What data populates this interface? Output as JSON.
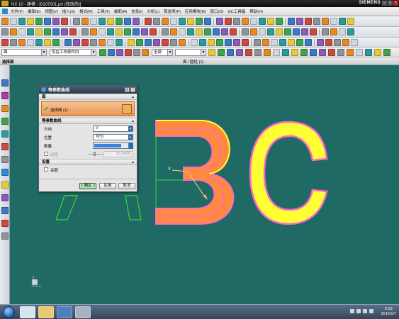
{
  "window": {
    "title": "NX 10 - 建模 - [0107001.prt (修改的)]",
    "brand": "SIEMENS",
    "controls": [
      "–",
      "□",
      "×"
    ]
  },
  "menubar": {
    "items": [
      "文件(F)",
      "编辑(E)",
      "视图(V)",
      "插入(S)",
      "格式(R)",
      "工具(T)",
      "装配(A)",
      "信息(I)",
      "分析(L)",
      "首选项(P)",
      "应用模块(N)",
      "窗口(O)",
      "GC工具箱",
      "帮助(H)"
    ]
  },
  "selection_bar": {
    "filter_value": "面",
    "scope_value": "仅在工作部件内",
    "snap_value": "全部"
  },
  "header_strip": {
    "left_label": "选择面",
    "center_label": "面 / 圆柱 (1)"
  },
  "dialog": {
    "title": "等参数曲线",
    "title_buttons": [
      "↺",
      "×"
    ],
    "face_section": {
      "heading": "面",
      "selection_label": "选择面 (1)"
    },
    "curve_section": {
      "heading": "等参数曲线",
      "direction_label": "方向",
      "direction_value": "V",
      "position_label": "位置",
      "position_value": "均匀",
      "count_label": "数量",
      "spacing_label": "间距",
      "spacing_value": "25.0000"
    },
    "settings_section": {
      "heading": "设置",
      "associative_label": "关联"
    },
    "buttons": {
      "ok": "< 确定 >",
      "apply": "应用",
      "cancel": "取消"
    }
  },
  "scene": {
    "triad_label": "V",
    "colors": {
      "background": "#1f6a64",
      "letter_fill": "#ffff33",
      "face_highlight": "#ff8a3d",
      "outline_pink": "#ff66cc",
      "wireframe": "#33dd33"
    }
  },
  "taskbar": {
    "time": "9:33",
    "date": "2016/1/7"
  }
}
